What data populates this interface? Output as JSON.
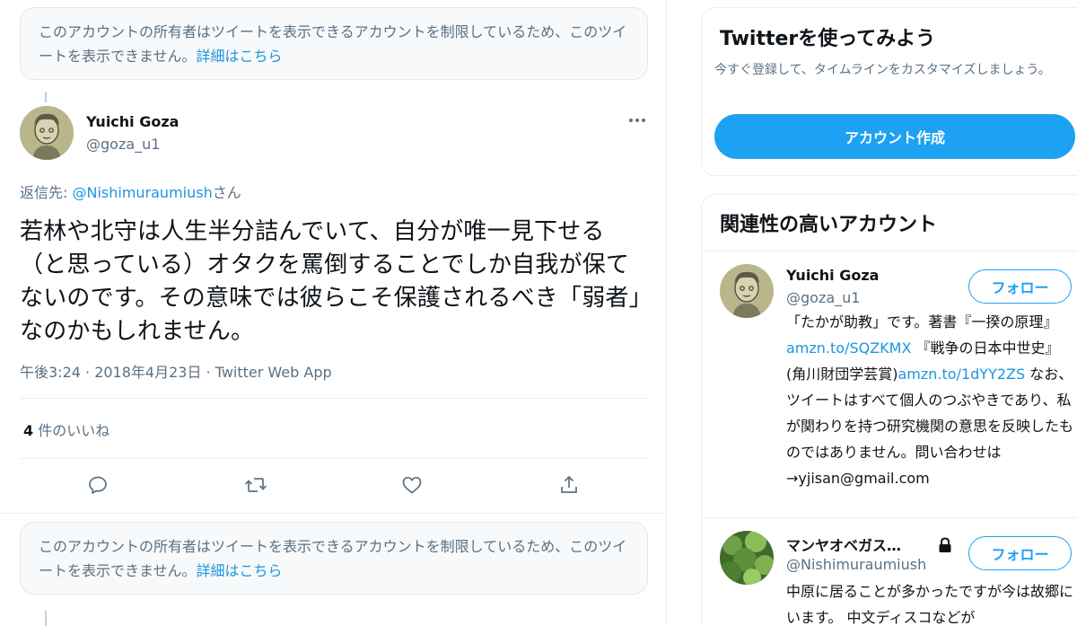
{
  "restricted_notice": {
    "text": "このアカウントの所有者はツイートを表示できるアカウントを制限しているため、このツイートを表示できません。",
    "link": "詳細はこちら"
  },
  "tweet": {
    "author_name": "Yuichi Goza",
    "author_handle": "@goza_u1",
    "more_icon": "more-horizontal-icon",
    "reply_prefix": "返信先: ",
    "reply_handle": "@Nishimuraumiush",
    "reply_suffix": "さん",
    "text": "若林や北守は人生半分詰んでいて、自分が唯一見下せる（と思っている）オタクを罵倒することでしか自我が保てないのです。その意味では彼らこそ保護されるべき「弱者」なのかもしれません。",
    "meta": "午後3:24 · 2018年4月23日 · Twitter Web App",
    "likes_count": "4",
    "likes_label": " 件のいいね",
    "actions": [
      "reply-icon",
      "retweet-icon",
      "like-icon",
      "share-icon"
    ]
  },
  "sidebar": {
    "try_twitter": {
      "title": "Twitterを使ってみよう",
      "subtitle": "今すぐ登録して、タイムラインをカスタマイズしましょう。",
      "button": "アカウント作成"
    },
    "related": {
      "title": "関連性の高いアカウント",
      "accounts": [
        {
          "name": "Yuichi Goza",
          "handle": "@goza_u1",
          "follow": "フォロー",
          "bio_parts": [
            {
              "text": "「たかが助教」です。著書『一揆の原理』",
              "link": false
            },
            {
              "text": "amzn.to/SQZKMX",
              "link": true
            },
            {
              "text": " 『戦争の日本中世史』(角川財団学芸賞)",
              "link": false
            },
            {
              "text": "amzn.to/1dYY2ZS",
              "link": true
            },
            {
              "text": " なお、ツイートはすべて個人のつぶやきであり、私が関わりを持つ研究機関の意思を反映したものではありません。問い合わせは→yjisan@gmail.com",
              "link": false
            }
          ]
        },
        {
          "name": "マンヤオベガス…",
          "handle": "@Nishimuraumiush",
          "follow": "フォロー",
          "locked_icon": "lock-icon",
          "bio": "中原に居ることが多かったですが今は故郷にいます。 中文ディスコなどが"
        }
      ]
    }
  }
}
